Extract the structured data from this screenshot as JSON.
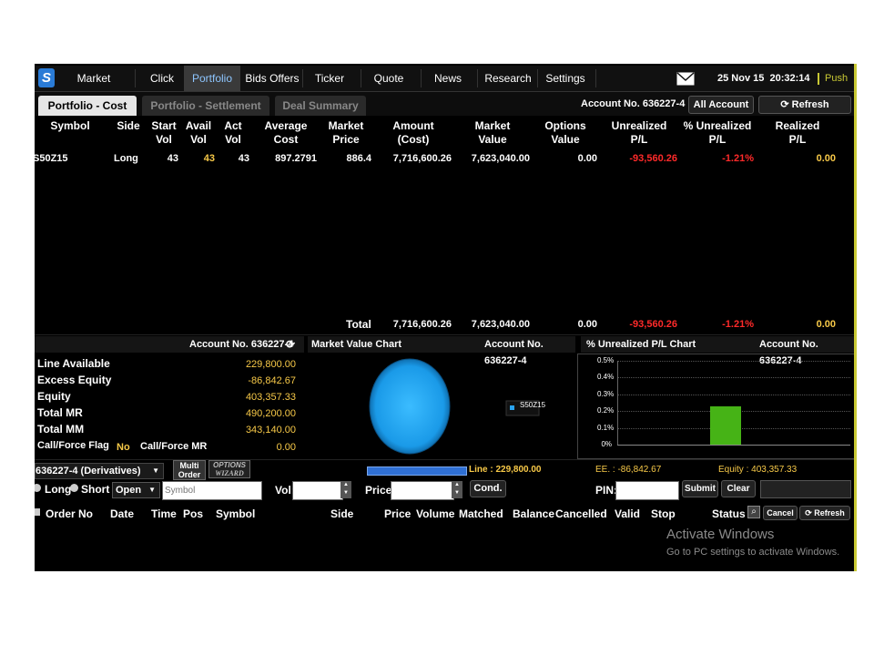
{
  "nav": {
    "items": [
      "Market",
      "Click",
      "Portfolio",
      "Bids Offers",
      "Ticker",
      "Quote",
      "News",
      "Research",
      "Settings"
    ],
    "active": "Portfolio",
    "date": "25 Nov 15",
    "time": "20:32:14",
    "push": "Push"
  },
  "tabs": [
    "Portfolio - Cost",
    "Portfolio - Settlement",
    "Deal Summary"
  ],
  "account_label": "Account No. 636227-4",
  "all_account": "All Account",
  "refresh": "Refresh",
  "table": {
    "headers": [
      [
        "Symbol"
      ],
      [
        "Side"
      ],
      [
        "Start",
        "Vol"
      ],
      [
        "Avail",
        "Vol"
      ],
      [
        "Act",
        "Vol"
      ],
      [
        "Average",
        "Cost"
      ],
      [
        "Market",
        "Price"
      ],
      [
        "Amount",
        "(Cost)"
      ],
      [
        "Market",
        "Value"
      ],
      [
        "Options",
        "Value"
      ],
      [
        "Unrealized",
        "P/L"
      ],
      [
        "% Unrealized",
        "P/L"
      ],
      [
        "Realized",
        "P/L"
      ]
    ],
    "row": {
      "symbol": "S50Z15",
      "side": "Long",
      "start_vol": "43",
      "avail_vol": "43",
      "act_vol": "43",
      "avg_cost": "897.2791",
      "market_price": "886.4",
      "amount_cost": "7,716,600.26",
      "market_value": "7,623,040.00",
      "options_value": "0.00",
      "unrealized": "-93,560.26",
      "pct_unrealized": "-1.21%",
      "realized": "0.00"
    },
    "total": {
      "label": "Total",
      "amount_cost": "7,716,600.26",
      "market_value": "7,623,040.00",
      "options_value": "0.00",
      "unrealized": "-93,560.26",
      "pct_unrealized": "-1.21%",
      "realized": "0.00"
    }
  },
  "summary": {
    "line_available": {
      "label": "Line Available",
      "value": "229,800.00"
    },
    "excess_equity": {
      "label": "Excess Equity",
      "value": "-86,842.67"
    },
    "equity": {
      "label": "Equity",
      "value": "403,357.33"
    },
    "total_mr": {
      "label": "Total MR",
      "value": "490,200.00"
    },
    "total_mm": {
      "label": "Total MM",
      "value": "343,140.00"
    },
    "call_force_flag": {
      "label": "Call/Force Flag",
      "value": "No"
    },
    "call_force_mr": {
      "label": "Call/Force MR",
      "value": "0.00"
    }
  },
  "market_value_chart": {
    "title": "Market Value Chart",
    "legend": "S50Z15",
    "color": "#29a3f0"
  },
  "pl_chart": {
    "title": "% Unrealized P/L Chart",
    "color": "#46b316"
  },
  "chart_data": {
    "type": "bar",
    "title": "% Unrealized P/L Chart",
    "yticks": [
      "0.5%",
      "0.4%",
      "0.3%",
      "0.2%",
      "0.1%",
      "0%"
    ],
    "ylim": [
      0,
      0.5
    ],
    "values": [
      0.23
    ]
  },
  "order_bar": {
    "account_select": "636227-4 (Derivatives)",
    "multi_order": [
      "Multi",
      "Order"
    ],
    "options_wizard": [
      "OPTIONS",
      "WIZARD"
    ],
    "line_label": "Line : 229,800.00",
    "ee_label": "EE. : -86,842.67",
    "equity_label": "Equity : 403,357.33",
    "long": "Long",
    "short": "Short",
    "open_select": "Open",
    "symbol_placeholder": "Symbol",
    "vol": "Vol:",
    "price": "Price:",
    "cond": "Cond.",
    "pin": "PIN:",
    "submit": "Submit",
    "clear": "Clear"
  },
  "order_headers": [
    "Order No",
    "Date",
    "Time",
    "Pos",
    "Symbol",
    "Side",
    "Price",
    "Volume",
    "Matched",
    "Balance",
    "Cancelled",
    "Valid",
    "Stop",
    "Status"
  ],
  "order_actions": {
    "cancel": "Cancel",
    "refresh": "Refresh"
  },
  "watermark": {
    "title": "Activate Windows",
    "sub": "Go to PC settings to activate Windows."
  }
}
